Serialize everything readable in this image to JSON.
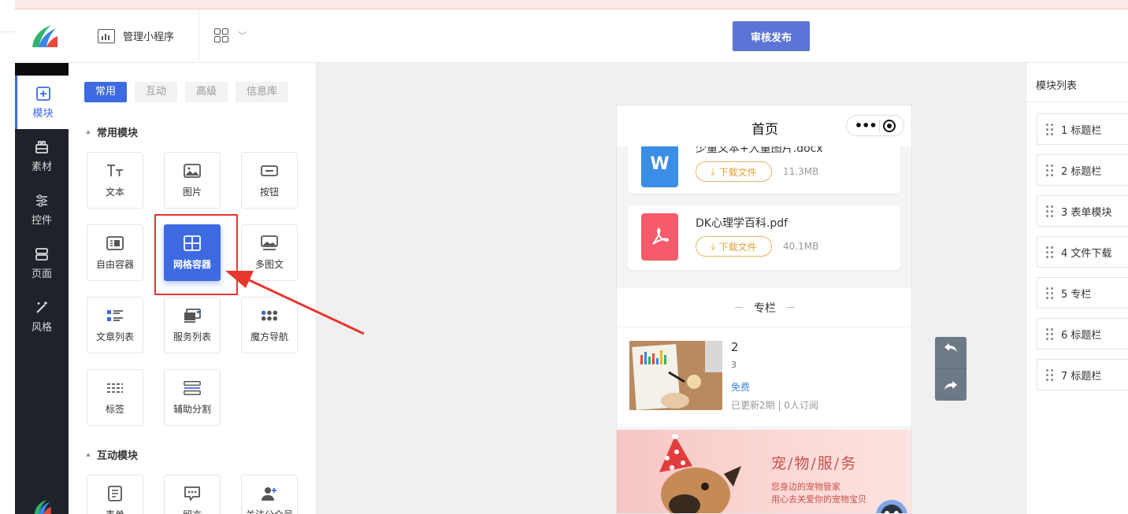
{
  "header": {
    "manage_label": "管理小程序",
    "publish_label": "审核发布"
  },
  "side_nav": [
    {
      "label": "模块",
      "icon": "plus-square-icon"
    },
    {
      "label": "素材",
      "icon": "material-icon"
    },
    {
      "label": "控件",
      "icon": "sliders-icon"
    },
    {
      "label": "页面",
      "icon": "pages-icon"
    },
    {
      "label": "风格",
      "icon": "magic-wand-icon"
    }
  ],
  "panel": {
    "tabs": [
      "常用",
      "互动",
      "高级",
      "信息库"
    ],
    "section_common": "常用模块",
    "section_interactive": "互动模块",
    "modules": [
      {
        "label": "文本",
        "icon": "text-icon"
      },
      {
        "label": "图片",
        "icon": "image-icon"
      },
      {
        "label": "按钮",
        "icon": "button-icon"
      },
      {
        "label": "自由容器",
        "icon": "free-container-icon"
      },
      {
        "label": "网格容器",
        "icon": "grid-container-icon"
      },
      {
        "label": "多图文",
        "icon": "multi-image-icon"
      },
      {
        "label": "文章列表",
        "icon": "article-list-icon"
      },
      {
        "label": "服务列表",
        "icon": "service-list-icon"
      },
      {
        "label": "魔方导航",
        "icon": "cube-nav-icon"
      },
      {
        "label": "标签",
        "icon": "tag-icon"
      },
      {
        "label": "辅助分割",
        "icon": "divider-icon"
      }
    ],
    "interactive_modules": [
      {
        "label": "表单",
        "icon": "form-icon"
      },
      {
        "label": "留言",
        "icon": "message-icon"
      },
      {
        "label": "关注公众号",
        "icon": "follow-icon"
      }
    ]
  },
  "phone": {
    "title": "首页",
    "files": [
      {
        "name": "少量文本+大量图片.docx",
        "download": "下载文件",
        "size": "11.3MB",
        "type": "word"
      },
      {
        "name": "DK心理学百科.pdf",
        "download": "下载文件",
        "size": "40.1MB",
        "type": "pdf"
      }
    ],
    "column": {
      "heading": "专栏",
      "title": "2",
      "subtitle": "3",
      "price": "免费",
      "meta": "已更新2期 | 0人订阅"
    },
    "banner": {
      "title": "宠/物/服/务",
      "line1": "您身边的宠物管家",
      "line2": "用心去关爱你的宠物宝贝"
    }
  },
  "right_panel": {
    "title": "模块列表",
    "items": [
      "1 标题栏",
      "2 标题栏",
      "3 表单模块",
      "4 文件下载",
      "5 专栏",
      "6 标题栏",
      "7 标题栏"
    ]
  },
  "colors": {
    "accent": "#3e6ae1",
    "publish": "#5b74d6",
    "highlight": "#e8362f"
  }
}
